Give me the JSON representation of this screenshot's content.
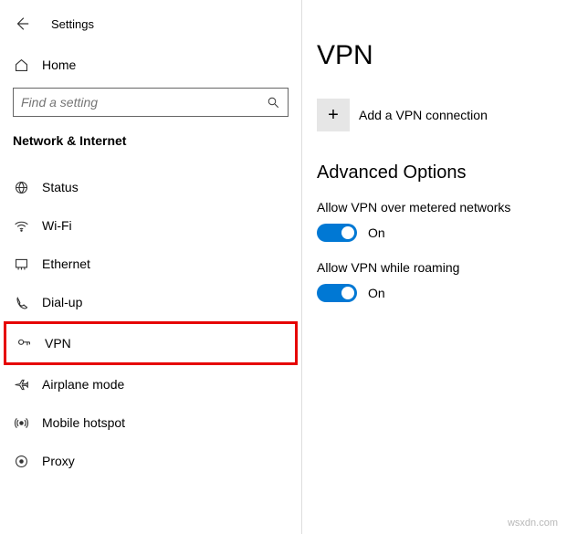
{
  "header": {
    "title": "Settings"
  },
  "home": {
    "label": "Home"
  },
  "search": {
    "placeholder": "Find a setting"
  },
  "category": {
    "label": "Network & Internet"
  },
  "nav": {
    "items": [
      {
        "label": "Status"
      },
      {
        "label": "Wi-Fi"
      },
      {
        "label": "Ethernet"
      },
      {
        "label": "Dial-up"
      },
      {
        "label": "VPN"
      },
      {
        "label": "Airplane mode"
      },
      {
        "label": "Mobile hotspot"
      },
      {
        "label": "Proxy"
      }
    ]
  },
  "main": {
    "title": "VPN",
    "add_label": "Add a VPN connection",
    "advanced_title": "Advanced Options",
    "opt1": {
      "label": "Allow VPN over metered networks",
      "state": "On"
    },
    "opt2": {
      "label": "Allow VPN while roaming",
      "state": "On"
    }
  },
  "watermark": "wsxdn.com"
}
